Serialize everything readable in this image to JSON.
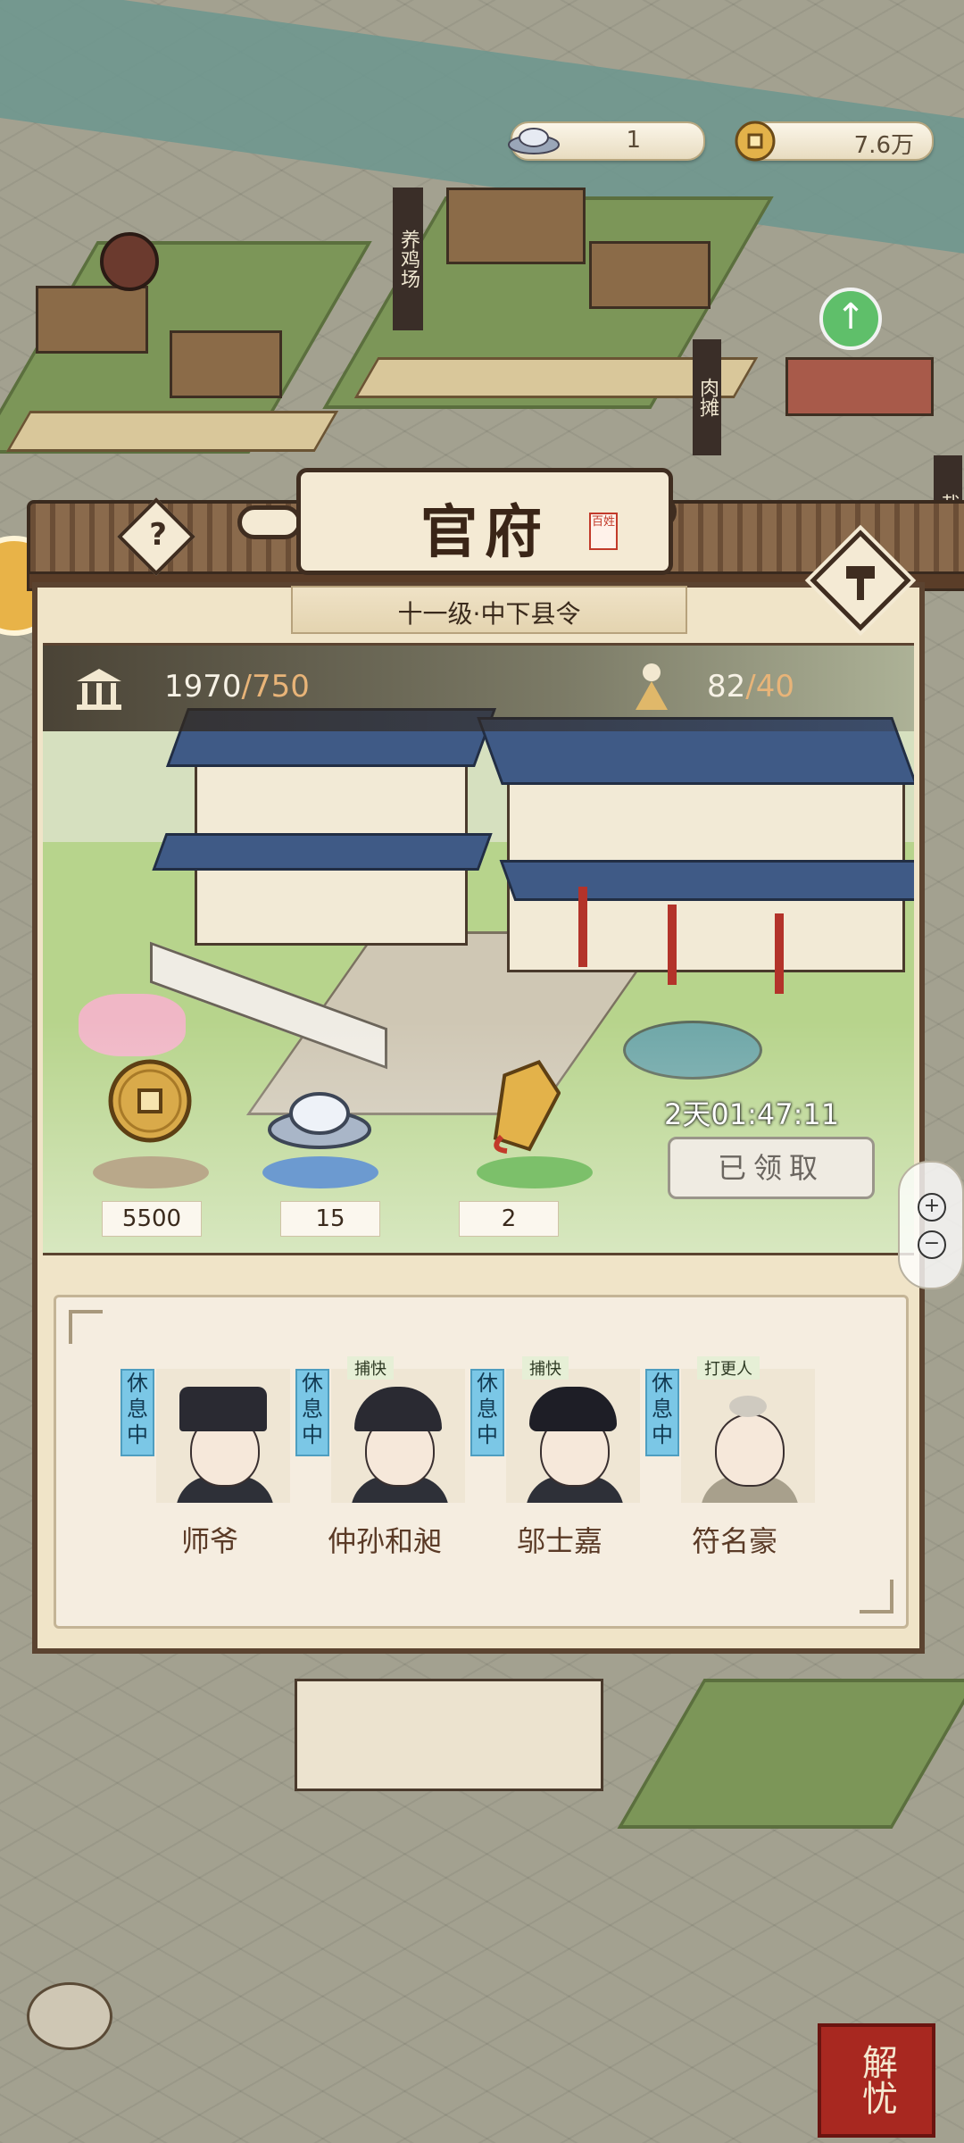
{
  "top_bar": {
    "silver": {
      "icon": "silver-ingot-icon",
      "value": "1"
    },
    "coins": {
      "icon": "copper-coin-icon",
      "value": "7.6万"
    }
  },
  "map_signs": {
    "sign_1": "养鸡场",
    "sign_2": "肉摊",
    "sign_3": "裁缝"
  },
  "dialog": {
    "title": "官府",
    "seal": "百姓",
    "rank": "十一级·中下县令",
    "stats": {
      "building": {
        "icon": "pavilion-icon",
        "current": "1970",
        "max": "/750"
      },
      "population": {
        "icon": "person-icon",
        "current": "82",
        "max": "/40"
      }
    },
    "rewards": [
      {
        "icon": "copper-coin-icon",
        "count": "5500"
      },
      {
        "icon": "silver-ingot-icon",
        "count": "15"
      },
      {
        "icon": "token-plaque-icon",
        "count": "2"
      }
    ],
    "timer": "2天01:47:11",
    "claim_button": "已领取",
    "staff": [
      {
        "name": "师爷",
        "status": "休息中",
        "role": ""
      },
      {
        "name": "仲孙和昶",
        "status": "休息中",
        "role": "捕快"
      },
      {
        "name": "邬士嘉",
        "status": "休息中",
        "role": "捕快"
      },
      {
        "name": "符名豪",
        "status": "休息中",
        "role": "打更人"
      }
    ]
  },
  "side": {
    "jieyou": "解忧",
    "zoom_in": "+",
    "zoom_out": "−"
  },
  "colors": {
    "frame": "#5b4330",
    "panel": "#f0e4c8",
    "rest_tag": "#7bc7e6",
    "roof_tile": "#3f5a86"
  }
}
